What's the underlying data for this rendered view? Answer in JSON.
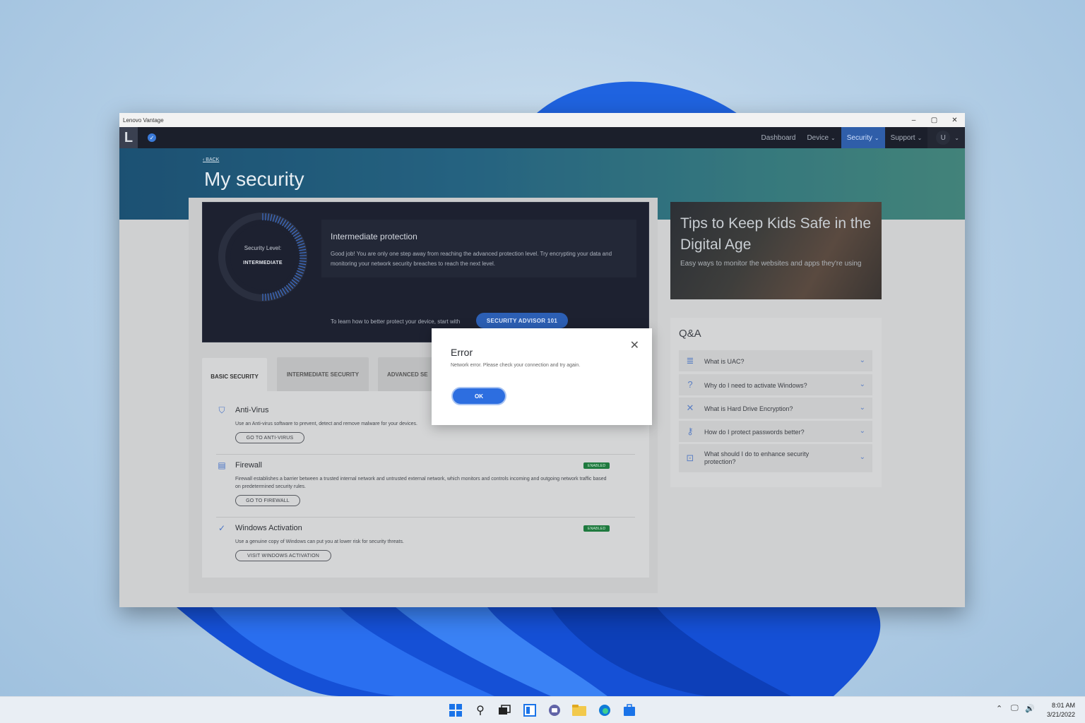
{
  "window": {
    "title": "Lenovo Vantage",
    "controls": {
      "minimize": "–",
      "restore": "▢",
      "close": "✕"
    }
  },
  "nav": {
    "logo": "L",
    "items": [
      {
        "label": "Dashboard",
        "has_chevron": false
      },
      {
        "label": "Device",
        "has_chevron": true
      },
      {
        "label": "Security",
        "has_chevron": true,
        "active": true
      },
      {
        "label": "Support",
        "has_chevron": true
      }
    ],
    "user_initial": "U"
  },
  "header": {
    "back_label": "BACK",
    "page_title": "My security"
  },
  "security_level": {
    "label": "Security Level:",
    "level": "INTERMEDIATE",
    "heading": "Intermediate protection",
    "description": "Good job! You are only one step away from reaching the advanced protection level. Try encrypting your data and monitoring your network security breaches to reach the next level.",
    "advisor_text": "To learn how to better protect your device, start with",
    "advisor_button": "SECURITY ADVISOR 101",
    "progress_fraction": 0.5
  },
  "tabs": [
    {
      "label": "BASIC SECURITY",
      "active": true
    },
    {
      "label": "INTERMEDIATE SECURITY",
      "active": false
    },
    {
      "label": "ADVANCED SE",
      "active": false
    }
  ],
  "security_items": [
    {
      "title": "Anti-Virus",
      "description": "Use an Anti-virus software to prevent, detect and remove malware for your devices.",
      "button": "GO TO ANTI-VIRUS",
      "badge": "",
      "icon": "shield-icon"
    },
    {
      "title": "Firewall",
      "description": "Firewall establishes a barrier between a trusted internal network and untrusted external network, which monitors and controls incoming and outgoing network traffic based on predetermined security rules.",
      "button": "GO TO FIREWALL",
      "badge": "ENABLED",
      "icon": "firewall-icon"
    },
    {
      "title": "Windows Activation",
      "description": "Use a genuine copy of Windows can put you at lower risk for security threats.",
      "button": "VISIT WINDOWS ACTIVATION",
      "badge": "ENABLED",
      "icon": "check-circle-icon"
    }
  ],
  "promo": {
    "title": "Tips to Keep Kids Safe in the Digital Age",
    "subtitle": "Easy ways to monitor the websites and apps they're using"
  },
  "qa": {
    "title": "Q&A",
    "items": [
      {
        "question": "What is UAC?",
        "icon": "database-icon"
      },
      {
        "question": "Why do I need to activate Windows?",
        "icon": "question-icon"
      },
      {
        "question": "What is Hard Drive Encryption?",
        "icon": "tools-icon"
      },
      {
        "question": "How do I protect passwords better?",
        "icon": "key-icon"
      },
      {
        "question": "What should I do to enhance security protection?",
        "icon": "lock-icon"
      }
    ]
  },
  "dialog": {
    "title": "Error",
    "message": "Network error. Please check your connection and try again.",
    "ok_label": "OK"
  },
  "taskbar": {
    "time": "8:01 AM",
    "date": "3/21/2022"
  },
  "colors": {
    "accent": "#2d6ee0",
    "nav_bg": "#1b1f2b",
    "enabled_badge": "#1f7a3f"
  }
}
